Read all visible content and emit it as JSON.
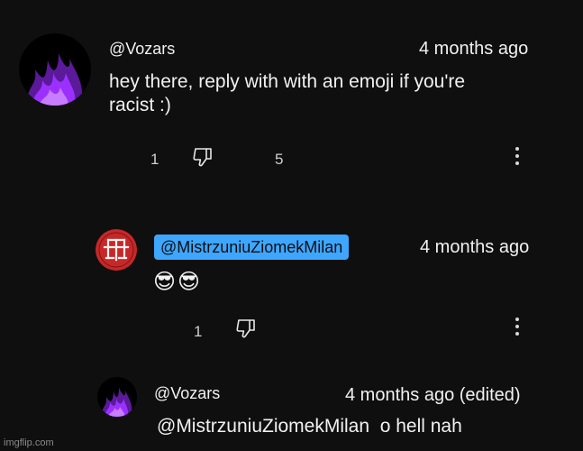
{
  "comment": {
    "author": "@Vozars",
    "time": "4 months ago",
    "text_line1": "hey there, reply with with an emoji if you're",
    "text_line2": "racist :)",
    "likes": "1",
    "reply_count": "5"
  },
  "reply1": {
    "author": "@MistrzuniuZiomekMilan",
    "time": "4 months ago",
    "text": "😎😎",
    "likes": "1"
  },
  "reply2": {
    "author": "@Vozars",
    "time": "4 months ago (edited)",
    "text": "@MistrzuniuZiomekMilan  o hell nah"
  },
  "watermark": "imgflip.com",
  "colors": {
    "background": "#0f0f0f",
    "mention_chip": "#3ea6ff",
    "purple_flame": "#8a2be2",
    "red_logo": "#c62828"
  },
  "icons": [
    "thumb-down-icon",
    "more-vert-icon",
    "purple-flame-avatar",
    "red-logo-avatar"
  ]
}
